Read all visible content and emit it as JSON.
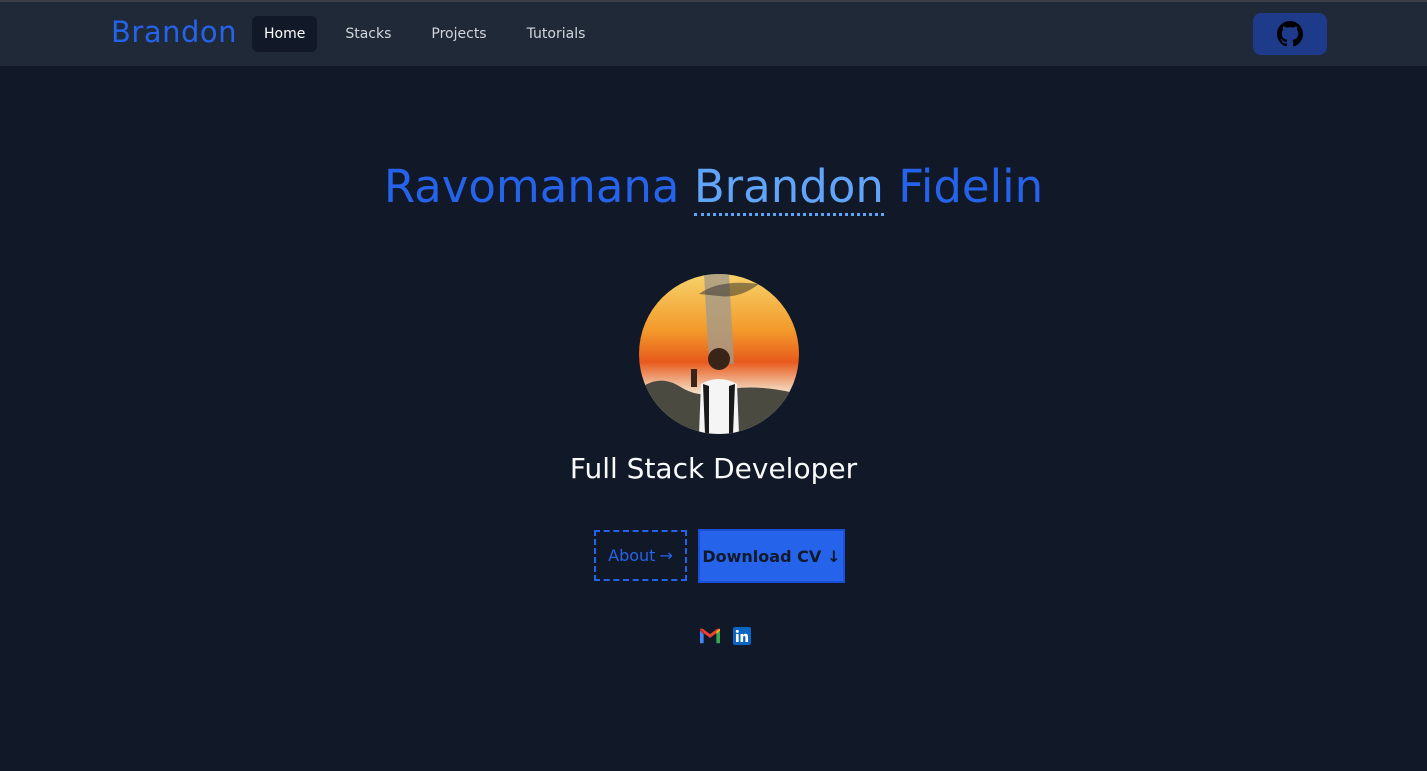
{
  "nav": {
    "brand": "Brandon",
    "links": [
      {
        "label": "Home",
        "active": true
      },
      {
        "label": "Stacks"
      },
      {
        "label": "Projects"
      },
      {
        "label": "Tutorials"
      }
    ],
    "github_icon": "github-icon"
  },
  "hero": {
    "name_first": "Ravomanana",
    "name_middle": "Brandon",
    "name_last": "Fidelin",
    "role": "Full Stack Developer",
    "about_label": "About",
    "about_arrow": "→",
    "cv_label": "Download CV",
    "cv_arrow": "↓"
  },
  "socials": [
    "gmail-icon",
    "linkedin-icon"
  ],
  "colors": {
    "background": "#111827",
    "navbar": "#1f2937",
    "accent": "#2563eb",
    "accent_light": "#60a5fa",
    "github_button": "#1e3a8a"
  }
}
